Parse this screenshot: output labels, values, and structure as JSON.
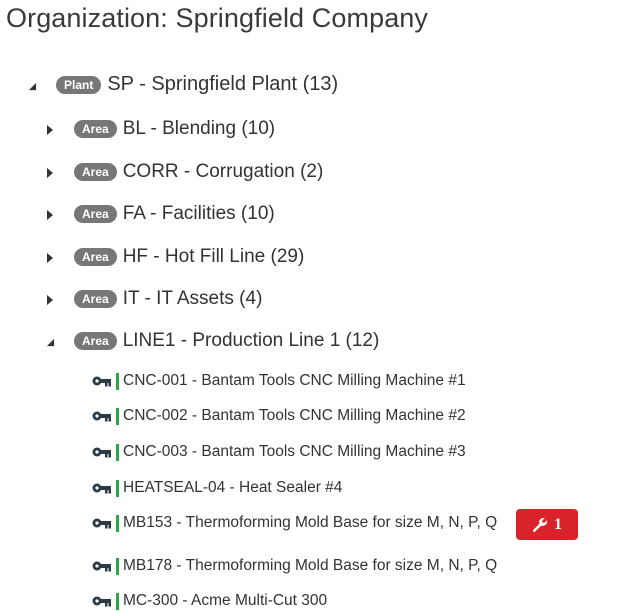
{
  "page": {
    "title": "Organization: Springfield Company"
  },
  "tree": {
    "plant": {
      "badge": "Plant",
      "label": "SP - Springfield Plant (13)",
      "expanded": true
    },
    "areas": [
      {
        "badge": "Area",
        "label": "BL - Blending (10)",
        "expanded": false
      },
      {
        "badge": "Area",
        "label": "CORR - Corrugation (2)",
        "expanded": false
      },
      {
        "badge": "Area",
        "label": "FA - Facilities (10)",
        "expanded": false
      },
      {
        "badge": "Area",
        "label": "HF - Hot Fill Line (29)",
        "expanded": false
      },
      {
        "badge": "Area",
        "label": "IT - IT Assets (4)",
        "expanded": false
      },
      {
        "badge": "Area",
        "label": "LINE1 - Production Line 1 (12)",
        "expanded": true
      }
    ],
    "assets": [
      {
        "label": "CNC-001 - Bantam Tools CNC Milling Machine #1",
        "status_color": "#2aa845"
      },
      {
        "label": "CNC-002 - Bantam Tools CNC Milling Machine #2",
        "status_color": "#2aa845"
      },
      {
        "label": "CNC-003 - Bantam Tools CNC Milling Machine #3",
        "status_color": "#2aa845"
      },
      {
        "label": "HEATSEAL-04 - Heat Sealer #4",
        "status_color": "#2aa845"
      },
      {
        "label": "MB153 - Thermoforming Mold Base for size M, N, P, Q",
        "status_color": "#2aa845",
        "work_orders": "1"
      },
      {
        "label": "MB178 - Thermoforming Mold Base for size M, N, P, Q",
        "status_color": "#2aa845"
      },
      {
        "label": "MC-300 - Acme Multi-Cut 300",
        "status_color": "#2aa845"
      }
    ]
  },
  "icons": {
    "collapsed": "caret-right-icon",
    "expanded": "caret-down-icon",
    "asset": "key-asset-icon",
    "work_order": "wrench-icon"
  },
  "colors": {
    "badge": "#777777",
    "status_ok": "#2aa845",
    "work_order": "#d9232a"
  }
}
